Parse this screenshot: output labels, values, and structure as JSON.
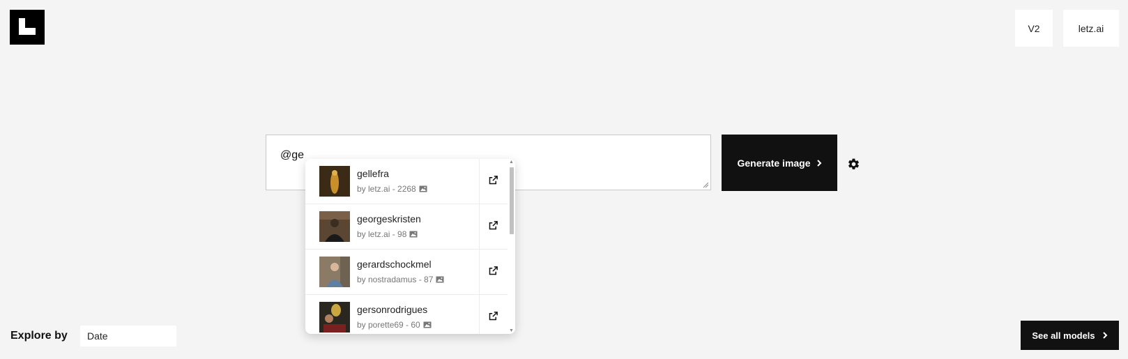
{
  "header": {
    "version_label": "V2",
    "site_label": "letz.ai"
  },
  "prompt": {
    "value": "@ge"
  },
  "generate_button": {
    "label": "Generate image"
  },
  "suggestions": [
    {
      "name": "gellefra",
      "author": "by letz.ai - 2268",
      "thumb_colors": [
        "#3b2a16",
        "#c8902a"
      ]
    },
    {
      "name": "georgeskristen",
      "author": "by letz.ai - 98",
      "thumb_colors": [
        "#5a4632",
        "#1a1a1a"
      ]
    },
    {
      "name": "gerardschockmel",
      "author": "by nostradamus - 87",
      "thumb_colors": [
        "#8a7a66",
        "#5f7fa0"
      ]
    },
    {
      "name": "gersonrodrigues",
      "author": "by porette69 - 60",
      "thumb_colors": [
        "#2a2620",
        "#c9a640"
      ]
    }
  ],
  "explore": {
    "label": "Explore by",
    "sort_value": "Date"
  },
  "see_all_button": {
    "label": "See all models"
  },
  "colors": {
    "background": "#f4f4f4",
    "dark": "#111111"
  }
}
